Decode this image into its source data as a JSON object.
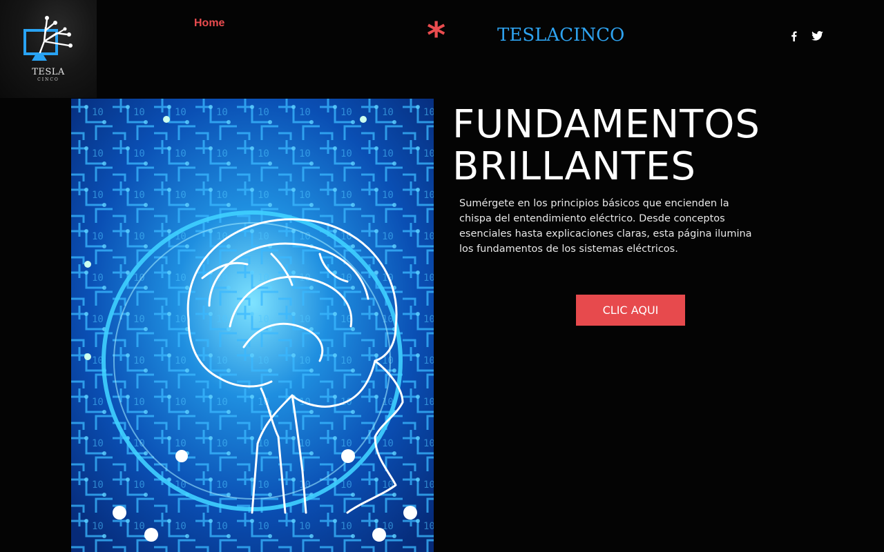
{
  "logo": {
    "word": "TESLA",
    "sub": "CINCO",
    "icon": "monitor-circuit-icon"
  },
  "nav": {
    "home_label": "Home"
  },
  "brand": {
    "asterisk": "*",
    "name": "TESLACINCO"
  },
  "social": {
    "facebook_icon": "facebook-icon",
    "twitter_icon": "twitter-icon"
  },
  "hero": {
    "image_icon": "brain-circuit-image",
    "title_line1": "FUNDAMENTOS",
    "title_line2": "BRILLANTES",
    "description": "Sumérgete en los principios básicos que encienden la chispa del entendimiento eléctrico. Desde conceptos esenciales hasta explicaciones claras, esta página ilumina los fundamentos de los sistemas eléctricos.",
    "cta_label": "CLIC AQUI"
  },
  "colors": {
    "background": "#040404",
    "accent_red": "#ea4c4f",
    "brand_blue": "#2ea3f0",
    "cta_bg": "#e74a4d"
  }
}
